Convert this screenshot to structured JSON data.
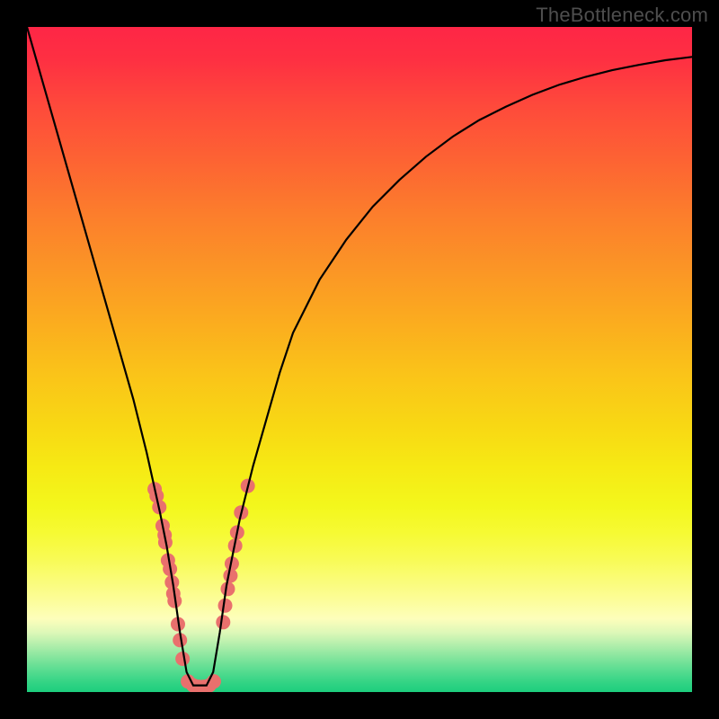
{
  "watermark": "TheBottleneck.com",
  "chart_data": {
    "type": "line",
    "title": "",
    "xlabel": "",
    "ylabel": "",
    "xlim": [
      0,
      100
    ],
    "ylim": [
      0,
      100
    ],
    "series": [
      {
        "name": "bottleneck-curve",
        "x": [
          0,
          2,
          4,
          6,
          8,
          10,
          12,
          14,
          16,
          18,
          20,
          21,
          22,
          23,
          24,
          25,
          26,
          27,
          28,
          29,
          30,
          32,
          34,
          36,
          38,
          40,
          44,
          48,
          52,
          56,
          60,
          64,
          68,
          72,
          76,
          80,
          84,
          88,
          92,
          96,
          100
        ],
        "y": [
          100,
          93,
          86,
          79,
          72,
          65,
          58,
          51,
          44,
          36,
          27,
          22,
          16,
          9,
          3,
          1,
          1,
          1,
          3,
          9,
          16,
          26,
          34,
          41,
          48,
          54,
          62,
          68,
          73,
          77,
          80.5,
          83.5,
          86,
          88,
          89.8,
          91.3,
          92.5,
          93.5,
          94.3,
          95,
          95.5
        ]
      }
    ],
    "annotations": {
      "dot_clusters": [
        {
          "name": "left-dots",
          "points": [
            {
              "x": 19.2,
              "y": 30.5
            },
            {
              "x": 19.5,
              "y": 29.5
            },
            {
              "x": 19.9,
              "y": 27.8
            },
            {
              "x": 20.4,
              "y": 25.0
            },
            {
              "x": 20.7,
              "y": 23.6
            },
            {
              "x": 20.8,
              "y": 22.5
            },
            {
              "x": 21.2,
              "y": 19.8
            },
            {
              "x": 21.5,
              "y": 18.5
            },
            {
              "x": 21.8,
              "y": 16.5
            },
            {
              "x": 22.0,
              "y": 14.8
            },
            {
              "x": 22.2,
              "y": 13.7
            },
            {
              "x": 22.7,
              "y": 10.2
            },
            {
              "x": 23.0,
              "y": 7.8
            },
            {
              "x": 23.4,
              "y": 5.0
            }
          ]
        },
        {
          "name": "bottom-dots",
          "points": [
            {
              "x": 24.2,
              "y": 1.6
            },
            {
              "x": 25.0,
              "y": 1.0
            },
            {
              "x": 25.8,
              "y": 0.8
            },
            {
              "x": 26.6,
              "y": 0.8
            },
            {
              "x": 27.4,
              "y": 1.0
            },
            {
              "x": 28.1,
              "y": 1.6
            }
          ]
        },
        {
          "name": "right-dots",
          "points": [
            {
              "x": 29.5,
              "y": 10.5
            },
            {
              "x": 29.8,
              "y": 13.0
            },
            {
              "x": 30.2,
              "y": 15.5
            },
            {
              "x": 30.6,
              "y": 17.5
            },
            {
              "x": 30.8,
              "y": 19.3
            },
            {
              "x": 31.3,
              "y": 22.0
            },
            {
              "x": 31.6,
              "y": 24.0
            },
            {
              "x": 32.2,
              "y": 27.0
            },
            {
              "x": 33.2,
              "y": 31.0
            }
          ]
        }
      ],
      "dot_color": "#e9706d",
      "dot_radius_px": 8
    },
    "gradient_background": {
      "top_color": "#fe2646",
      "bottom_color": "#1cce7d"
    }
  }
}
